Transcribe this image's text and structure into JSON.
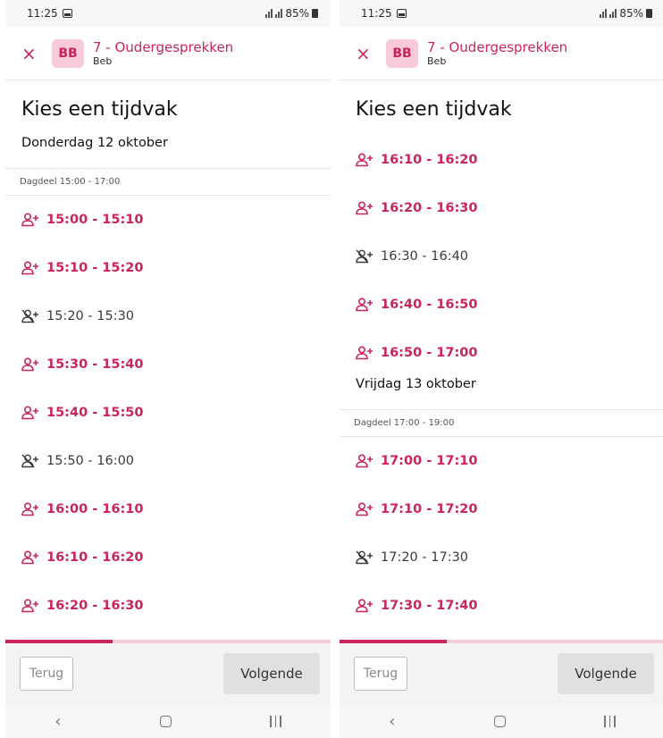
{
  "screens": [
    {
      "status": {
        "time": "11:25",
        "battery": "85%"
      },
      "header": {
        "avatar": "BB",
        "title": "7 - Oudergesprekken",
        "subtitle": "Beb",
        "close_glyph": "×"
      },
      "page_title": "Kies een tijdvak",
      "day1": {
        "label": "Donderdag 12 oktober",
        "dagdeel": "Dagdeel 15:00 - 17:00"
      },
      "slots": [
        {
          "time": "15:00 - 15:10",
          "available": true
        },
        {
          "time": "15:10 - 15:20",
          "available": true
        },
        {
          "time": "15:20 - 15:30",
          "available": false
        },
        {
          "time": "15:30 - 15:40",
          "available": true
        },
        {
          "time": "15:40 - 15:50",
          "available": true
        },
        {
          "time": "15:50 - 16:00",
          "available": false
        },
        {
          "time": "16:00 - 16:10",
          "available": true
        },
        {
          "time": "16:10 - 16:20",
          "available": true
        },
        {
          "time": "16:20 - 16:30",
          "available": true
        }
      ],
      "progress": 0.33,
      "buttons": {
        "back": "Terug",
        "next": "Volgende"
      },
      "nav": {
        "back_glyph": "‹"
      }
    },
    {
      "status": {
        "time": "11:25",
        "battery": "85%"
      },
      "header": {
        "avatar": "BB",
        "title": "7 - Oudergesprekken",
        "subtitle": "Beb",
        "close_glyph": "×"
      },
      "page_title": "Kies een tijdvak",
      "slots_a": [
        {
          "time": "16:10 - 16:20",
          "available": true
        },
        {
          "time": "16:20 - 16:30",
          "available": true
        },
        {
          "time": "16:30 - 16:40",
          "available": false
        },
        {
          "time": "16:40 - 16:50",
          "available": true
        },
        {
          "time": "16:50 - 17:00",
          "available": true
        }
      ],
      "day2": {
        "label": "Vrijdag 13 oktober",
        "dagdeel": "Dagdeel 17:00 - 19:00"
      },
      "slots_b": [
        {
          "time": "17:00 - 17:10",
          "available": true
        },
        {
          "time": "17:10 - 17:20",
          "available": true
        },
        {
          "time": "17:20 - 17:30",
          "available": false
        },
        {
          "time": "17:30 - 17:40",
          "available": true
        }
      ],
      "progress": 0.33,
      "buttons": {
        "back": "Terug",
        "next": "Volgende"
      },
      "nav": {
        "back_glyph": "‹"
      }
    }
  ],
  "colors": {
    "accent": "#c9245b",
    "accent_light": "#f8c9d8",
    "unavailable": "#3a3a3a"
  }
}
